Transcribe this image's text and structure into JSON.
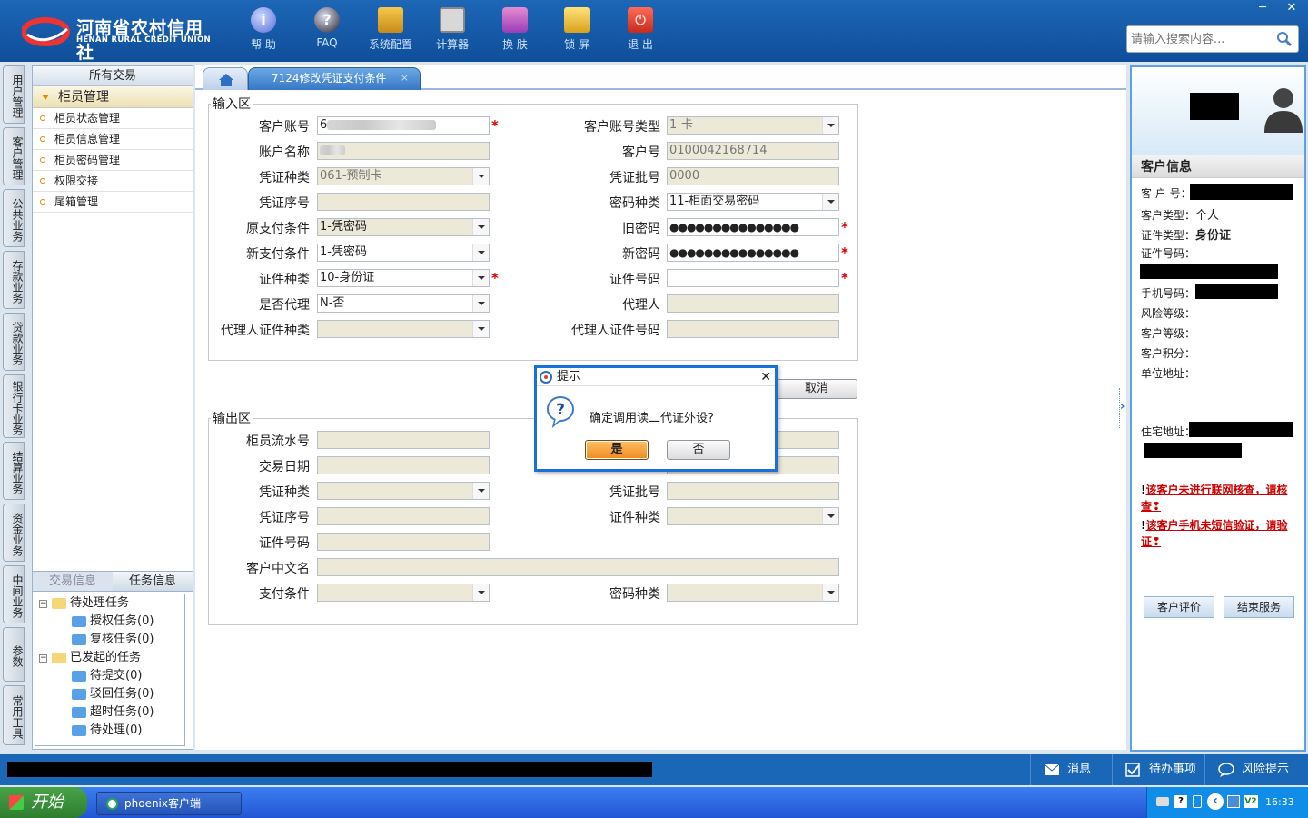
{
  "app": {
    "logo_cn": "河南省农村信用社",
    "logo_en": "HENAN RURAL CREDIT UNION"
  },
  "toolbar": [
    {
      "label": "帮 助",
      "icon": "help-icon"
    },
    {
      "label": "FAQ",
      "icon": "faq-icon"
    },
    {
      "label": "系统配置",
      "icon": "toolbox-icon"
    },
    {
      "label": "计算器",
      "icon": "calculator-icon"
    },
    {
      "label": "换 肤",
      "icon": "shirt-icon"
    },
    {
      "label": "锁 屏",
      "icon": "lock-icon"
    },
    {
      "label": "退 出",
      "icon": "power-icon"
    }
  ],
  "window": {
    "minimize": "─",
    "close": "✕"
  },
  "search": {
    "placeholder": "请输入搜索内容..."
  },
  "vtabs": [
    "用户管理",
    "客户管理",
    "公共业务",
    "存款业务",
    "贷款业务",
    "银行卡业务",
    "结算业务",
    "资金业务",
    "中间业务",
    "参数",
    "常用工具"
  ],
  "nav": {
    "title": "所有交易",
    "group": "柜员管理",
    "items": [
      "柜员状态管理",
      "柜员信息管理",
      "柜员密码管理",
      "权限交接",
      "尾箱管理"
    ]
  },
  "task_panel": {
    "tabs": [
      "交易信息",
      "任务信息"
    ],
    "tree": {
      "pending": "待处理任务",
      "auth": "授权任务(0)",
      "review": "复核任务(0)",
      "initiated": "已发起的任务",
      "to_submit": "待提交(0)",
      "rejected": "驳回任务(0)",
      "timeout": "超时任务(0)",
      "to_process": "待处理(0)"
    }
  },
  "tabs": {
    "current": "7124修改凭证支付条件",
    "close": "×"
  },
  "input_area": {
    "legend": "输入区",
    "customer_account_label": "客户账号",
    "customer_account_value": "6",
    "account_type_label": "客户账号类型",
    "account_type_value": "1-卡",
    "account_name_label": "账户名称",
    "customer_no_label": "客户号",
    "customer_no_value": "0100042168714",
    "voucher_type_label": "凭证种类",
    "voucher_type_value": "061-预制卡",
    "voucher_batch_label": "凭证批号",
    "voucher_batch_value": "0000",
    "voucher_seq_label": "凭证序号",
    "pwd_type_label": "密码种类",
    "pwd_type_value": "11-柜面交易密码",
    "old_cond_label": "原支付条件",
    "old_cond_value": "1-凭密码",
    "old_pwd_label": "旧密码",
    "old_pwd_value": "●●●●●●●●●●●●●●●",
    "new_cond_label": "新支付条件",
    "new_cond_value": "1-凭密码",
    "new_pwd_label": "新密码",
    "new_pwd_value": "●●●●●●●●●●●●●●●",
    "id_type_label": "证件种类",
    "id_type_value": "10-身份证",
    "id_no_label": "证件号码",
    "agent_flag_label": "是否代理",
    "agent_flag_value": "N-否",
    "agent_label": "代理人",
    "agent_id_type_label": "代理人证件种类",
    "agent_id_no_label": "代理人证件号码",
    "required_mark": "*"
  },
  "cancel_button": "取消",
  "output_area": {
    "legend": "输出区",
    "teller_seq_label": "柜员流水号",
    "trade_date_label": "交易日期",
    "voucher_type_label": "凭证种类",
    "voucher_batch_label": "凭证批号",
    "voucher_seq_label": "凭证序号",
    "id_type_label": "证件种类",
    "id_no_label": "证件号码",
    "cn_name_label": "客户中文名",
    "pay_cond_label": "支付条件",
    "pwd_type_label": "密码种类"
  },
  "dialog": {
    "title": "提示",
    "message": "确定调用读二代证外设?",
    "yes": "是",
    "no": "否",
    "close": "✕"
  },
  "customer_info": {
    "title": "客户信息",
    "cust_no_label": "客 户 号：",
    "cust_type_label": "客户类型：",
    "cust_type_value": "个人",
    "id_type_label": "证件类型：",
    "id_type_value": "身份证",
    "id_no_label": "证件号码：",
    "phone_label": "手机号码：",
    "risk_label": "风险等级：",
    "level_label": "客户等级：",
    "points_label": "客户积分：",
    "company_label": "单位地址：",
    "home_label": "住宅地址：",
    "warn1": "该客户未进行联网核查，请核查",
    "warn2": "该客户手机未短信验证，请验证",
    "warn_mark": "!",
    "warn_end": "❢",
    "eval_button": "客户评价",
    "end_button": "结束服务"
  },
  "status_bar": {
    "msg": "消息",
    "todo": "待办事项",
    "risk": "风险提示"
  },
  "taskbar": {
    "start": "开始",
    "app": "phoenix客户端",
    "time": "16:33",
    "tray_badge": "V2"
  },
  "colors": {
    "header": "#1d67b6",
    "accent": "#1a6fd8",
    "warning": "#cc0000"
  }
}
